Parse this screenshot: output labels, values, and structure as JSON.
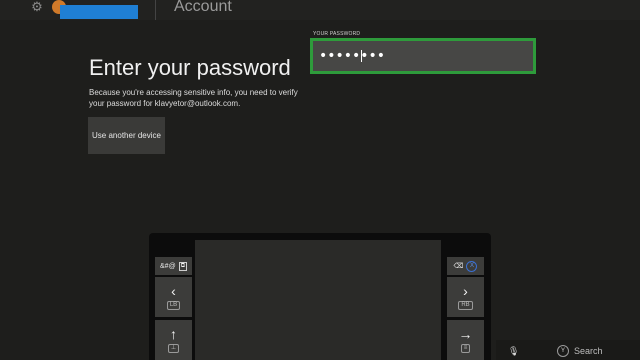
{
  "header": {
    "breadcrumb": "Account",
    "gear_icon": "gear-icon"
  },
  "main": {
    "title": "Enter your password",
    "description": "Because you're accessing sensitive info, you need to verify your password for klavyetor@outlook.com.",
    "other_device_label": "Use another device"
  },
  "password": {
    "label": "YOUR PASSWORD",
    "value": "••••••••"
  },
  "keyboard": {
    "symbols_key": "&#@",
    "left_key": "‹",
    "right_key": "›",
    "up_key": "↑",
    "enter_key": "→",
    "backspace_button": "X",
    "left_sub": "LB",
    "right_sub": "RB"
  },
  "footer": {
    "search_label": "Search",
    "search_button": "Y"
  },
  "colors": {
    "focus_border": "#2e9b3b",
    "avatar": "#d07a2a",
    "redaction": "#1f7fd4"
  }
}
